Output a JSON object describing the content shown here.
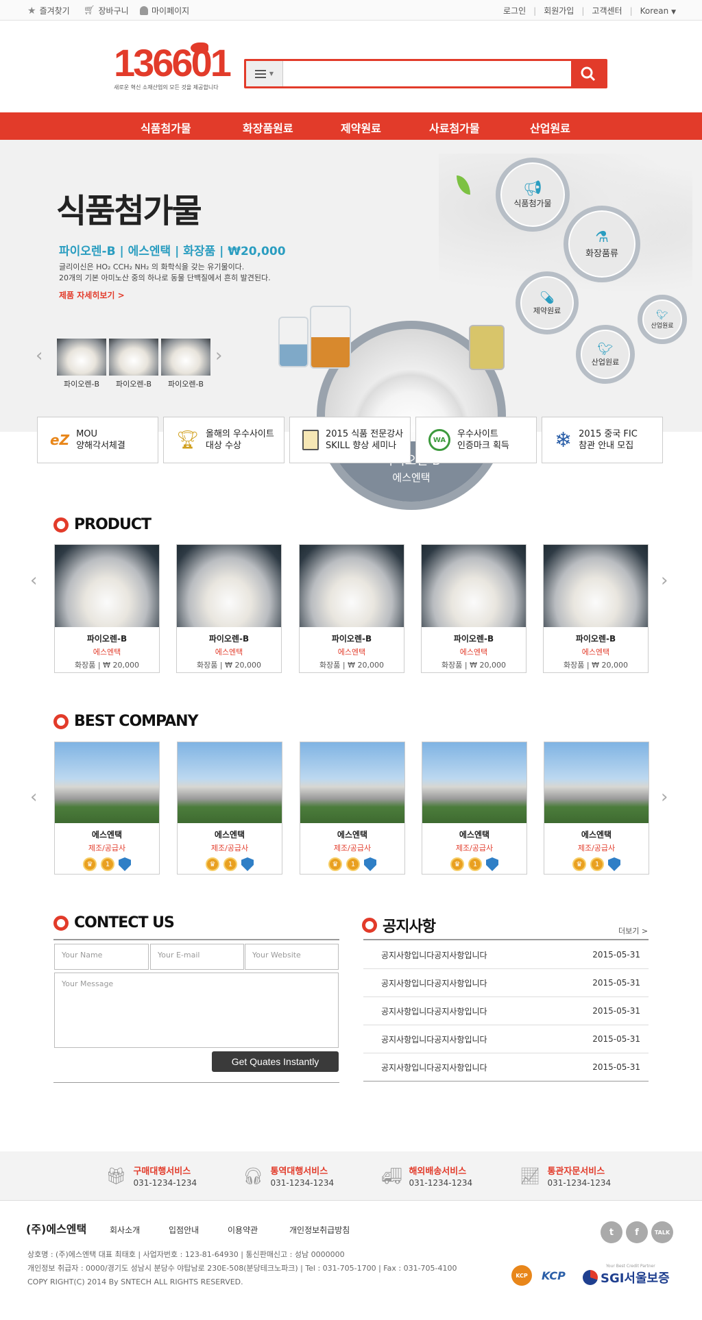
{
  "topbar": {
    "bookmark": "즐겨찾기",
    "cart": "장바구니",
    "mypage": "마이페이지",
    "login": "로그인",
    "join": "회원가입",
    "support": "고객센터",
    "language": "Korean"
  },
  "logo": {
    "text": "136601",
    "tagline": "새로운 혁신 소재산업의 모든 것을 제공합니다"
  },
  "search": {
    "placeholder": ""
  },
  "nav": [
    "식품첨가물",
    "화장품원료",
    "제약원료",
    "사료첨가물",
    "산업원료"
  ],
  "hero": {
    "title": "식품첨가물",
    "subtitle": "파이오렌-B | 에스엔택 | 화장품 | ₩20,000",
    "desc1": "글리이신은 HO₂ CCH₂ NH₂ 의 화학식을 갖는 유기물이다.",
    "desc2": "20개의 기본 아미노산 중의 하나로 동물 단백질에서 흔히 발견된다.",
    "more": "제품 자세히보기 >",
    "thumbs": [
      "파이오렌-B",
      "파이오렌-B",
      "파이오렌-B"
    ],
    "product_name": "파이오렌-B",
    "product_company": "에스엔택",
    "circles": [
      "식품첨가물",
      "화장품류",
      "제약원료",
      "산업원료",
      "산업원료"
    ]
  },
  "badges": [
    {
      "l1": "MOU",
      "l2": "양해각서체결"
    },
    {
      "l1": "올해의 우수사이트",
      "l2": "대상 수상"
    },
    {
      "l1": "2015 식품 전문강사",
      "l2": "SKILL 향상 세미나"
    },
    {
      "l1": "우수사이트",
      "l2": "인증마크 획득"
    },
    {
      "l1": "2015 중국 FIC",
      "l2": "참관 안내 모집"
    }
  ],
  "product": {
    "title": "PRODUCT",
    "items": [
      {
        "name": "파이오렌-B",
        "company": "에스엔택",
        "price": "화장품 | ₩ 20,000"
      },
      {
        "name": "파이오렌-B",
        "company": "에스엔택",
        "price": "화장품 | ₩ 20,000"
      },
      {
        "name": "파이오렌-B",
        "company": "에스엔택",
        "price": "화장품 | ₩ 20,000"
      },
      {
        "name": "파이오렌-B",
        "company": "에스엔택",
        "price": "화장품 | ₩ 20,000"
      },
      {
        "name": "파이오렌-B",
        "company": "에스엔택",
        "price": "화장품 | ₩ 20,000"
      }
    ]
  },
  "company": {
    "title": "BEST COMPANY",
    "items": [
      {
        "name": "에스엔택",
        "type": "제조/공급사"
      },
      {
        "name": "에스엔택",
        "type": "제조/공급사"
      },
      {
        "name": "에스엔택",
        "type": "제조/공급사"
      },
      {
        "name": "에스엔택",
        "type": "제조/공급사"
      },
      {
        "name": "에스엔택",
        "type": "제조/공급사"
      }
    ]
  },
  "contact": {
    "title": "CONTECT US",
    "name_ph": "Your Name",
    "email_ph": "Your E-mail",
    "web_ph": "Your Website",
    "msg_ph": "Your Message",
    "button": "Get Quates Instantly"
  },
  "notice": {
    "title": "공지사항",
    "more": "더보기 >",
    "items": [
      {
        "t": "공지사항입니다공지사항입니다",
        "d": "2015-05-31"
      },
      {
        "t": "공지사항입니다공지사항입니다",
        "d": "2015-05-31"
      },
      {
        "t": "공지사항입니다공지사항입니다",
        "d": "2015-05-31"
      },
      {
        "t": "공지사항입니다공지사항입니다",
        "d": "2015-05-31"
      },
      {
        "t": "공지사항입니다공지사항입니다",
        "d": "2015-05-31"
      }
    ]
  },
  "services": [
    {
      "t": "구매대행서비스",
      "p": "031-1234-1234"
    },
    {
      "t": "통역대행서비스",
      "p": "031-1234-1234"
    },
    {
      "t": "해외배송서비스",
      "p": "031-1234-1234"
    },
    {
      "t": "통관자문서비스",
      "p": "031-1234-1234"
    }
  ],
  "footer": {
    "company": "(주)에스엔택",
    "links": [
      "회사소개",
      "입점안내",
      "이용약관",
      "개인정보취급방침"
    ],
    "info1": "상호명 : (주)에스엔택 대표 최태호 | 사업자번호 : 123-81-64930 | 통신판매신고 : 성남 0000000",
    "info2": "개인정보 취급자 : 0000/경기도 성남시 분당수 야탑남로 230E-508(분당테크노파크) | Tel : 031-705-1700 | Fax : 031-705-4100",
    "copy": "COPY RIGHT(C) 2014 By SNTECH ALL RIGHTS RESERVED.",
    "sns": [
      "t",
      "f",
      "TALK"
    ],
    "certs": [
      "KCP",
      "KCP",
      "SGI서울보증"
    ],
    "sgi_small": "Your Best Credit Partner"
  },
  "colors": {
    "accent": "#e23b2a",
    "teal": "#2a9dc0"
  }
}
